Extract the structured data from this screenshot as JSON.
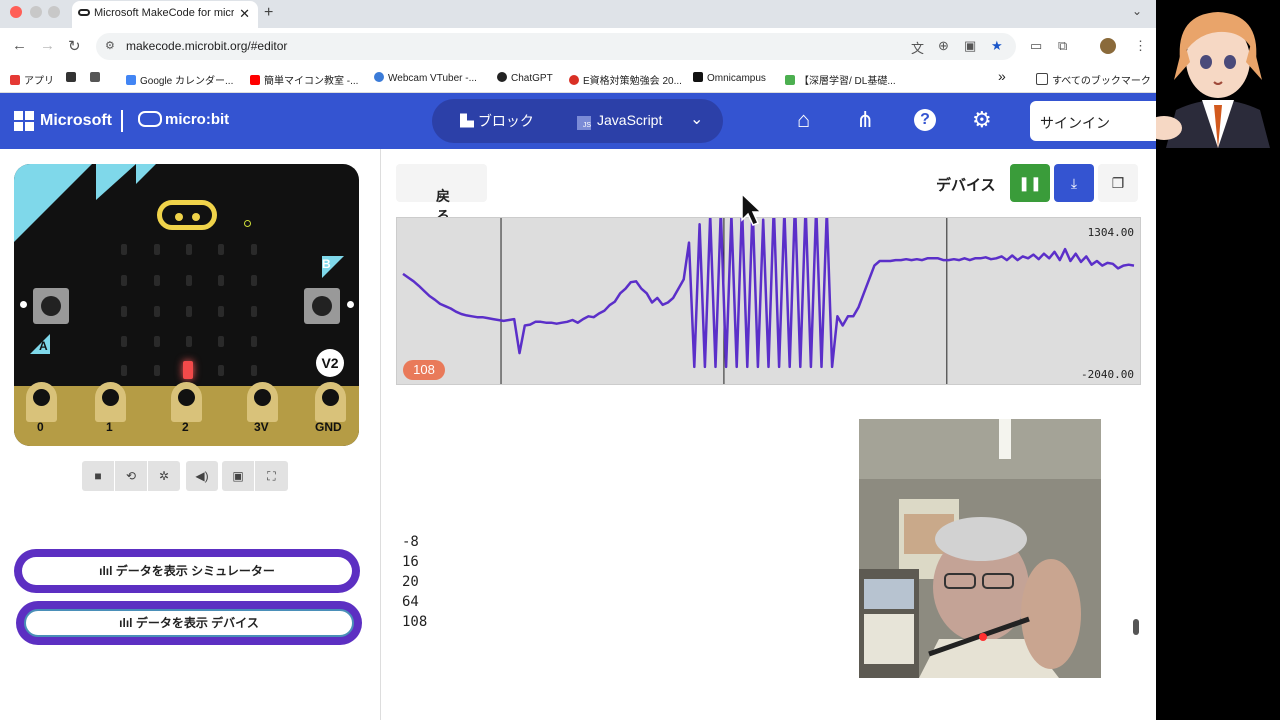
{
  "browser": {
    "tab_title": "Microsoft MakeCode for micro:bit",
    "tab_close": "✕",
    "new_tab": "+",
    "url": "makecode.microbit.org/#editor",
    "bookmarks": [
      {
        "label": "アプリ",
        "color": "#e53935"
      },
      {
        "label": "",
        "color": "#333333"
      },
      {
        "label": "",
        "color": "#555555"
      },
      {
        "label": "Google カレンダー...",
        "color": "#4285f4"
      },
      {
        "label": "簡単マイコン教室 -...",
        "color": "#ff0000"
      },
      {
        "label": "Webcam VTuber -...",
        "color": "#3b7bd8"
      },
      {
        "label": "ChatGPT",
        "color": "#222222"
      },
      {
        "label": "E資格対策勉強会 20...",
        "color": "#d93025"
      },
      {
        "label": "Omnicampus",
        "color": "#111111"
      },
      {
        "label": "【深層学習/ DL基礎...",
        "color": "#4caf50"
      }
    ],
    "bookmarks_more": "»",
    "bookmarks_folder": "すべてのブックマーク"
  },
  "header": {
    "microsoft": "Microsoft",
    "microbit": "micro:bit",
    "blocks_label": "ブロック",
    "javascript_label": "JavaScript",
    "signin_label": "サインイン",
    "brand_color": "#3454d1"
  },
  "simulator": {
    "pin_labels": [
      "0",
      "1",
      "2",
      "3V",
      "GND"
    ],
    "version": "V2",
    "button_a": "A",
    "button_b": "B",
    "show_data_simulator": "データを表示 シミュレーター",
    "show_data_device": "データを表示 デバイス"
  },
  "device_view": {
    "back_label": "戻る",
    "device_label": "デバイス",
    "max_label": "1304.00",
    "min_label": "-2040.00",
    "current_value": "108",
    "console_lines": [
      "-8",
      "16",
      "20",
      "64",
      "108"
    ]
  },
  "chart_data": {
    "type": "line",
    "ylim": [
      -2040,
      1304
    ],
    "current": 108,
    "series": [
      {
        "values": [
          220,
          140,
          60,
          -40,
          -150,
          -260,
          -340,
          -430,
          -480,
          -530,
          -600,
          -650,
          -680,
          -700,
          -720,
          -720,
          -740,
          -760,
          -780,
          -800,
          -780,
          -760,
          -1500,
          -900,
          -880,
          -820,
          -820,
          -840,
          -840,
          -860,
          -840,
          -820,
          -780,
          -840,
          -760,
          -700,
          -720,
          -640,
          -580,
          -460,
          -380,
          -200,
          -100,
          40,
          60,
          -100,
          -200,
          -400,
          -300,
          -450,
          -400,
          -300,
          -100,
          100,
          900,
          -1800,
          1300,
          -1800,
          1500,
          -1800,
          1600,
          -1800,
          1500,
          -1800,
          1700,
          -1800,
          1700,
          -1800,
          1400,
          -1800,
          1700,
          -1800,
          1600,
          -1800,
          1800,
          -1800,
          1700,
          -1800,
          1700,
          -1800,
          1600,
          -1800,
          -700,
          -900,
          -700,
          -700,
          -500,
          -200,
          100,
          400,
          500,
          500,
          500,
          520,
          520,
          540,
          520,
          540,
          520,
          560,
          560,
          560,
          520,
          520,
          540,
          520,
          560,
          520,
          560,
          560,
          580,
          540,
          560,
          600,
          520,
          620,
          520,
          600,
          560,
          640,
          540,
          660,
          560,
          700,
          520,
          760,
          500,
          660,
          480,
          600,
          420,
          500,
          400,
          460,
          440,
          340,
          400,
          420,
          400
        ]
      }
    ],
    "vertical_markers": [
      0.14,
      0.44,
      0.74
    ],
    "line_color": "#5b2fc9"
  }
}
